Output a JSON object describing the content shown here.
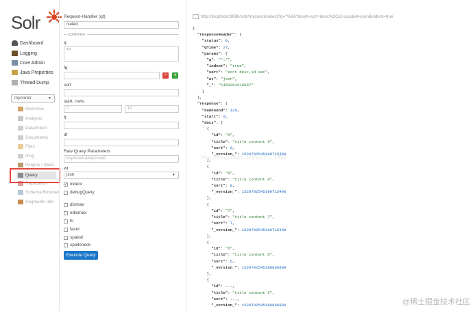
{
  "logo": {
    "text": "Solr"
  },
  "nav": [
    {
      "label": "Dashboard",
      "icon": "dashboard-icon"
    },
    {
      "label": "Logging",
      "icon": "logging-icon"
    },
    {
      "label": "Core Admin",
      "icon": "core-admin-icon"
    },
    {
      "label": "Java Properties",
      "icon": "java-icon"
    },
    {
      "label": "Thread Dump",
      "icon": "thread-icon"
    }
  ],
  "core_selector": {
    "value": "mycore1"
  },
  "core_nav": [
    {
      "label": "Overview"
    },
    {
      "label": "Analysis"
    },
    {
      "label": "Dataimport"
    },
    {
      "label": "Documents"
    },
    {
      "label": "Files"
    },
    {
      "label": "Ping"
    },
    {
      "label": "Plugins / Stats"
    },
    {
      "label": "Query",
      "active": true
    },
    {
      "label": "Replication"
    },
    {
      "label": "Schema Browser"
    },
    {
      "label": "Segments info"
    }
  ],
  "form": {
    "handler_label": "Request-Handler (qt)",
    "handler_value": "/select",
    "common_label": "common",
    "q_label": "q",
    "q_value": "*:*",
    "fq_label": "fq",
    "sort_label": "sort",
    "start_rows_label": "start, rows",
    "start_value": "0",
    "rows_value": "10",
    "fl_label": "fl",
    "df_label": "df",
    "raw_label": "Raw Query Parameters",
    "raw_placeholder": "key1=val1&key2=val2",
    "wt_label": "wt",
    "wt_value": "json",
    "indent_label": "indent",
    "debug_label": "debugQuery",
    "options": [
      "dismax",
      "edismax",
      "hl",
      "facet",
      "spatial",
      "spellcheck"
    ],
    "execute_label": "Execute Query"
  },
  "response": {
    "url": "http://localhost:8080/solr/mycore1/select?q=*%3A*&sort=sort+desc%2Cid+asc&wt=json&indent=true",
    "header": {
      "status": "0",
      "QTime": "27",
      "q": "\"*:*\"",
      "indent": "\"true\"",
      "sort": "\"sort desc,id asc\"",
      "wt": "\"json\"",
      "_": "\"1450284210687\""
    },
    "numFound": "120",
    "start": "0",
    "docs": [
      {
        "id": "\"9\"",
        "title": "\"title content 9\"",
        "sort": "9",
        "version": "1520702545190715400"
      },
      {
        "id": "\"8\"",
        "title": "\"title content 8\"",
        "sort": "8",
        "version": "1520702545190715400"
      },
      {
        "id": "\"7\"",
        "title": "\"title content 7\"",
        "sort": "7",
        "version": "1520702545190715400"
      },
      {
        "id": "\"6\"",
        "title": "\"title content 6\"",
        "sort": "6",
        "version": "1520702545189666800"
      },
      {
        "title": "\"title content 5\"",
        "version": "1520702545189666800"
      }
    ],
    "watermark": "http://blog.csdn.net/u01... 1995",
    "corner_watermark": "@稀土掘金技术社区"
  }
}
